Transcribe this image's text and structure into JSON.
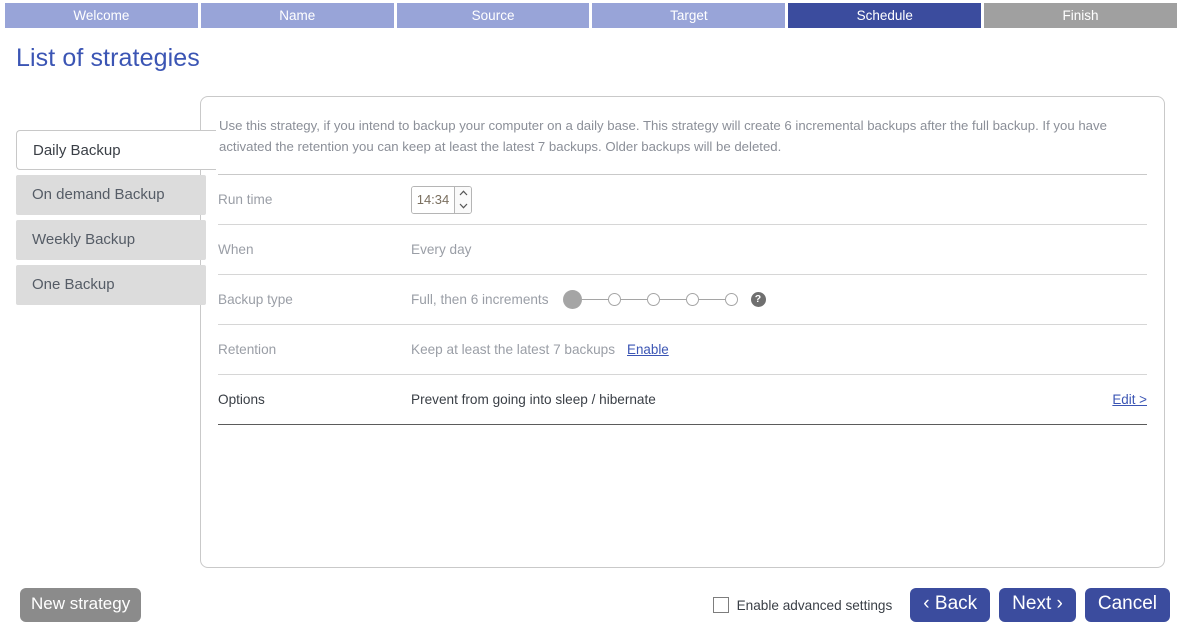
{
  "wizard": {
    "steps": [
      {
        "label": "Welcome",
        "state": "upcoming"
      },
      {
        "label": "Name",
        "state": "upcoming"
      },
      {
        "label": "Source",
        "state": "upcoming"
      },
      {
        "label": "Target",
        "state": "upcoming"
      },
      {
        "label": "Schedule",
        "state": "active"
      },
      {
        "label": "Finish",
        "state": "done"
      }
    ],
    "active_color": "#3b4c9e",
    "inactive_color": "#98a4d8",
    "done_color": "#a0a0a0"
  },
  "page": {
    "title": "List of strategies",
    "title_color": "#3b55b4"
  },
  "strategies": [
    {
      "label": "Daily Backup",
      "selected": true
    },
    {
      "label": "On demand Backup",
      "selected": false
    },
    {
      "label": "Weekly Backup",
      "selected": false
    },
    {
      "label": "One Backup",
      "selected": false
    }
  ],
  "detail": {
    "description": "Use this strategy, if you intend to backup your computer on a daily base. This strategy will create 6 incremental backups after the full backup. If you have activated the retention you can keep at least the latest 7 backups. Older backups will be deleted.",
    "run_time": {
      "label": "Run time",
      "value": "14:34",
      "increment_icon": "chevron-up-icon",
      "decrement_icon": "chevron-down-icon"
    },
    "when": {
      "label": "When",
      "value": "Every day"
    },
    "backup_type": {
      "label": "Backup type",
      "value": "Full, then 6 increments",
      "slider_steps": 5,
      "slider_selected_index": 0,
      "help_icon": "question-mark-icon",
      "help_label": "?"
    },
    "retention": {
      "label": "Retention",
      "value": "Keep at least the latest 7 backups",
      "action_label": "Enable"
    },
    "options": {
      "label": "Options",
      "value": "Prevent from going into sleep / hibernate",
      "action_label": "Edit >"
    }
  },
  "footer": {
    "new_strategy_label": "New strategy",
    "advanced_settings_label": "Enable advanced settings",
    "advanced_settings_checked": false,
    "back_label": "‹ Back",
    "next_label": "Next ›",
    "cancel_label": "Cancel"
  }
}
